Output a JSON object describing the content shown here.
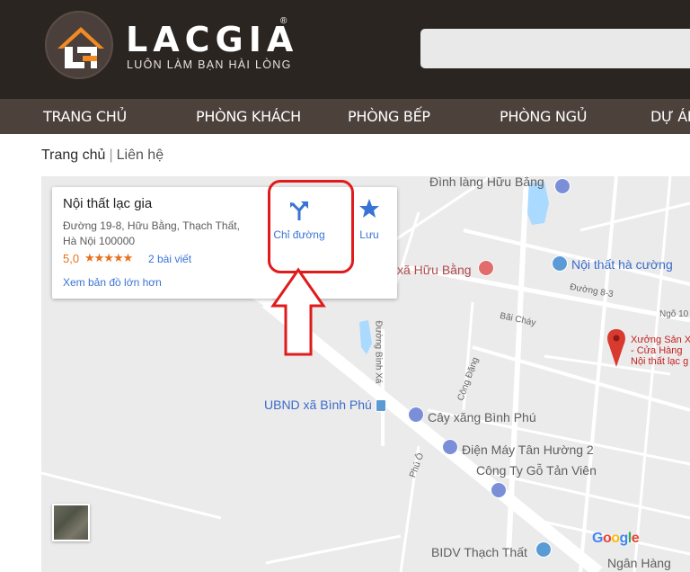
{
  "header": {
    "brand": "LACGIA",
    "registered": "®",
    "tagline": "LUÔN LÀM BẠN HÀI LÒNG",
    "logo_icon": "house-logo-icon"
  },
  "nav": {
    "items": [
      {
        "label": "TRANG CHỦ"
      },
      {
        "label": "PHÒNG KHÁCH"
      },
      {
        "label": "PHÒNG BẾP"
      },
      {
        "label": "PHÒNG NGỦ"
      },
      {
        "label": "DỰ ÁN"
      }
    ]
  },
  "breadcrumb": {
    "home": "Trang chủ",
    "separator": "|",
    "current": "Liên hệ"
  },
  "map_card": {
    "title": "Nội thất lạc gia",
    "address": "Đường 19-8, Hữu Bằng, Thạch Thất, Hà Nội 100000",
    "rating": "5,0",
    "stars": "★★★★★",
    "reviews": "2 bài viết",
    "larger_map": "Xem bản đồ lớn hơn",
    "directions": "Chỉ đường",
    "save": "Lưu"
  },
  "map_labels": {
    "dinh_lang": "Đình làng Hữu Bằng",
    "xa_huu_bang": "xã Hữu Bằng",
    "noi_that_ha_cuong": "Nội thất hà cường",
    "duong_8_3": "Đường 8-3",
    "ngo_10": "Ngõ 10",
    "bai_chay": "Bãi Cháy",
    "duong_binh_xa": "Đường Bình Xá",
    "cong_dang": "Công Đặng",
    "xuong_san_xuat_1": "Xưởng Sản X",
    "xuong_san_xuat_2": "- Cửa Hàng",
    "xuong_san_xuat_3": "Nội thất lạc g",
    "ubnd": "UBND xã Bình Phú",
    "cay_xang": "Cây xăng Bình Phú",
    "dien_may": "Điện Máy Tân Hường 2",
    "cong_ty_go": "Công Ty Gỗ Tản Viên",
    "phu_o": "Phú Ô",
    "bidv": "BIDV Thạch Thất",
    "ngan_hang": "Ngân Hàng",
    "google": "Google"
  },
  "colors": {
    "header_bg": "#2b2522",
    "nav_bg": "#4c413b",
    "annotation_red": "#e01b1b",
    "link_blue": "#3a73d6",
    "star_orange": "#e7711b"
  }
}
